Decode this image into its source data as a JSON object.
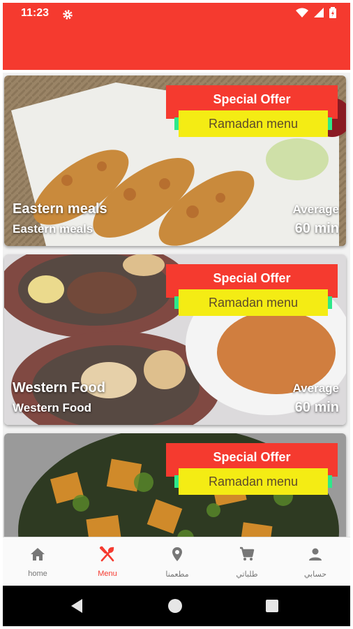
{
  "status_bar": {
    "time": "11:23"
  },
  "colors": {
    "accent": "#f53a2f",
    "badge_yellow": "#f4ec14",
    "badge_edge": "#2ee88a"
  },
  "cards": [
    {
      "offer": "Special Offer",
      "badge": "Ramadan menu",
      "title": "Eastern meals",
      "subtitle": "Eastern meals",
      "avg_label": "Average",
      "avg_time": "60 min"
    },
    {
      "offer": "Special Offer",
      "badge": "Ramadan menu",
      "title": "Western Food",
      "subtitle": "Western Food",
      "avg_label": "Average",
      "avg_time": "60 min"
    },
    {
      "offer": "Special Offer",
      "badge": "Ramadan menu"
    }
  ],
  "bottom_nav": [
    {
      "label": "home",
      "icon": "home-icon"
    },
    {
      "label": "Menu",
      "icon": "fork-spoon-icon",
      "active": true
    },
    {
      "label": "مطعمنا",
      "icon": "location-pin-icon"
    },
    {
      "label": "طلباتي",
      "icon": "cart-icon"
    },
    {
      "label": "حسابي",
      "icon": "person-icon"
    }
  ]
}
